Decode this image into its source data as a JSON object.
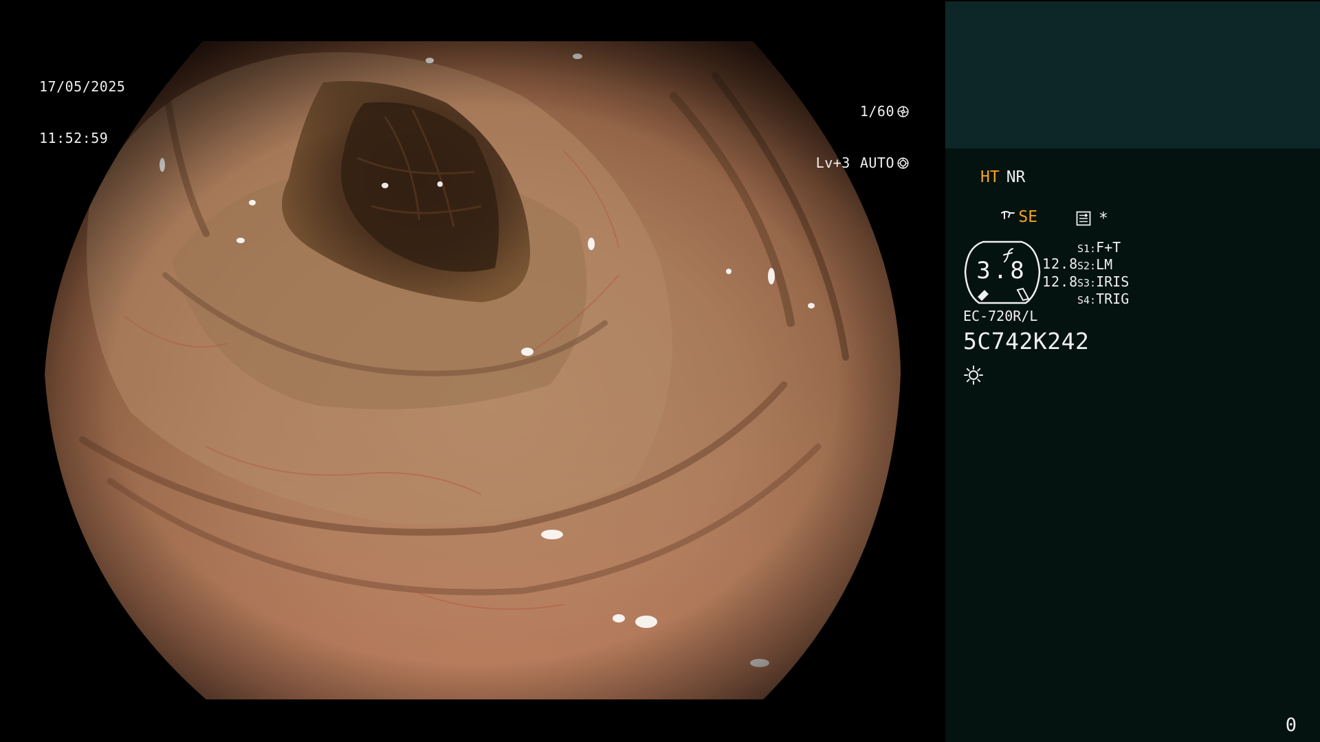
{
  "overlay": {
    "date": "17/05/2025",
    "time": "11:52:59",
    "shutter_speed": "1/60",
    "exposure_level": "Lv+3",
    "exposure_mode": "AUTO"
  },
  "sidebar": {
    "mode_ht": "HT",
    "mode_nr": "NR",
    "mode_se": "SE",
    "asterisk": "*",
    "gauge": {
      "value": "3.8",
      "side_top": "12.8",
      "side_bottom": "12.8"
    },
    "switches": [
      {
        "key": "S1:",
        "value": "F+T"
      },
      {
        "key": "S2:",
        "value": "LM"
      },
      {
        "key": "S3:",
        "value": "IRIS"
      },
      {
        "key": "S4:",
        "value": "TRIG"
      }
    ],
    "scope_model": "EC-720R/L",
    "scope_serial": "5C742K242",
    "counter": "0"
  },
  "colors": {
    "accent_amber": "#f3a41c",
    "sidebar_top_bg": "#0d2729",
    "sidebar_bg": "#041210",
    "osd_text": "#f0f0f0"
  },
  "icons": {
    "shutter": "aperture-icon",
    "auto": "iris-icon",
    "se": "scope-tip-icon",
    "structure": "f-curve-icon",
    "menu": "menu-list-icon",
    "light": "sun-icon"
  }
}
